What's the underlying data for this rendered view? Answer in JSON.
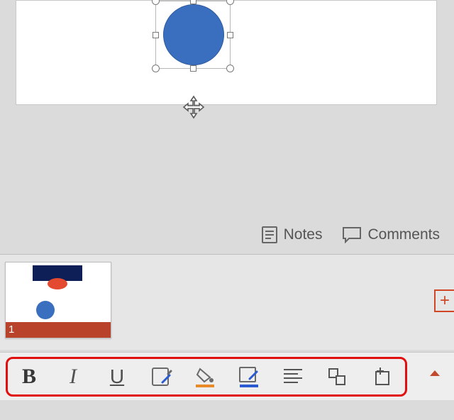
{
  "shape": {
    "type": "circle",
    "fill": "#3a6fbf",
    "selected": true
  },
  "view_bar": {
    "notes_label": "Notes",
    "comments_label": "Comments"
  },
  "thumbnail": {
    "slide_number": "1"
  },
  "toolbar": {
    "bold_glyph": "B",
    "italic_glyph": "I",
    "underline_glyph": "U",
    "highlight_color": "#e98a2a",
    "font_color_underline": "#2a5bd1"
  },
  "new_slide_glyph": "+"
}
